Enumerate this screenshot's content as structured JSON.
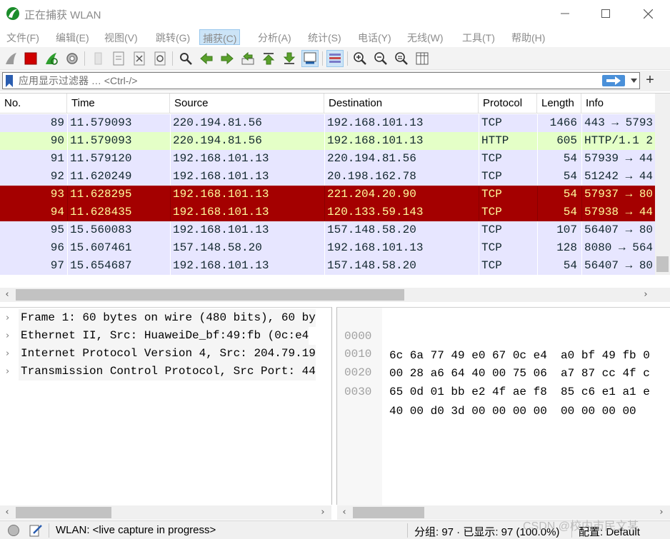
{
  "window": {
    "title": "正在捕获 WLAN"
  },
  "menu": [
    {
      "label": "文件(F)"
    },
    {
      "label": "编辑(E)"
    },
    {
      "label": "视图(V)"
    },
    {
      "label": "跳转(G)"
    },
    {
      "label": "捕获(C)"
    },
    {
      "label": "分析(A)"
    },
    {
      "label": "统计(S)"
    },
    {
      "label": "电话(Y)"
    },
    {
      "label": "无线(W)"
    },
    {
      "label": "工具(T)"
    },
    {
      "label": "帮助(H)"
    }
  ],
  "filter": {
    "placeholder": "应用显示过滤器 … <Ctrl-/>",
    "plus": "+"
  },
  "packet_list": {
    "columns": [
      "No.",
      "Time",
      "Source",
      "Destination",
      "Protocol",
      "Length",
      "Info"
    ],
    "rows": [
      {
        "no": "89",
        "time": "11.579093",
        "src": "220.194.81.56",
        "dst": "192.168.101.13",
        "proto": "TCP",
        "len": "1466",
        "info": "443 → 5793",
        "style": "tcp"
      },
      {
        "no": "90",
        "time": "11.579093",
        "src": "220.194.81.56",
        "dst": "192.168.101.13",
        "proto": "HTTP",
        "len": "605",
        "info": "HTTP/1.1 2",
        "style": "http"
      },
      {
        "no": "91",
        "time": "11.579120",
        "src": "192.168.101.13",
        "dst": "220.194.81.56",
        "proto": "TCP",
        "len": "54",
        "info": "57939 → 44",
        "style": "tcp"
      },
      {
        "no": "92",
        "time": "11.620249",
        "src": "192.168.101.13",
        "dst": "20.198.162.78",
        "proto": "TCP",
        "len": "54",
        "info": "51242 → 44",
        "style": "tcp"
      },
      {
        "no": "93",
        "time": "11.628295",
        "src": "192.168.101.13",
        "dst": "221.204.20.90",
        "proto": "TCP",
        "len": "54",
        "info": "57937 → 80",
        "style": "bad"
      },
      {
        "no": "94",
        "time": "11.628435",
        "src": "192.168.101.13",
        "dst": "120.133.59.143",
        "proto": "TCP",
        "len": "54",
        "info": "57938 → 44",
        "style": "bad"
      },
      {
        "no": "95",
        "time": "15.560083",
        "src": "192.168.101.13",
        "dst": "157.148.58.20",
        "proto": "TCP",
        "len": "107",
        "info": "56407 → 80",
        "style": "tcp"
      },
      {
        "no": "96",
        "time": "15.607461",
        "src": "157.148.58.20",
        "dst": "192.168.101.13",
        "proto": "TCP",
        "len": "128",
        "info": "8080 → 564",
        "style": "tcp"
      },
      {
        "no": "97",
        "time": "15.654687",
        "src": "192.168.101.13",
        "dst": "157.148.58.20",
        "proto": "TCP",
        "len": "54",
        "info": "56407 → 80",
        "style": "tcp"
      }
    ]
  },
  "details": [
    "Frame 1: 60 bytes on wire (480 bits), 60 by",
    "Ethernet II, Src: HuaweiDe_bf:49:fb (0c:e4",
    "Internet Protocol Version 4, Src: 204.79.19",
    "Transmission Control Protocol, Src Port: 44"
  ],
  "bytes": [
    {
      "offset": "0000",
      "hex": "6c 6a 77 49 e0 67 0c e4  a0 bf 49 fb 0"
    },
    {
      "offset": "0010",
      "hex": "00 28 a6 64 40 00 75 06  a7 87 cc 4f c"
    },
    {
      "offset": "0020",
      "hex": "65 0d 01 bb e2 4f ae f8  85 c6 e1 a1 e"
    },
    {
      "offset": "0030",
      "hex": "40 00 d0 3d 00 00 00 00  00 00 00 00"
    }
  ],
  "status": {
    "capture": "WLAN: <live capture in progress>",
    "counts": "分组: 97 · 已显示: 97 (100.0%)",
    "profile": "配置: Default"
  },
  "watermark": "CSDN @校内市民文某",
  "colors": {
    "tcp_row": "#e7e6ff",
    "http_row": "#e4ffc7",
    "bad_row": "#a40000",
    "bad_text": "#fffc9c"
  }
}
